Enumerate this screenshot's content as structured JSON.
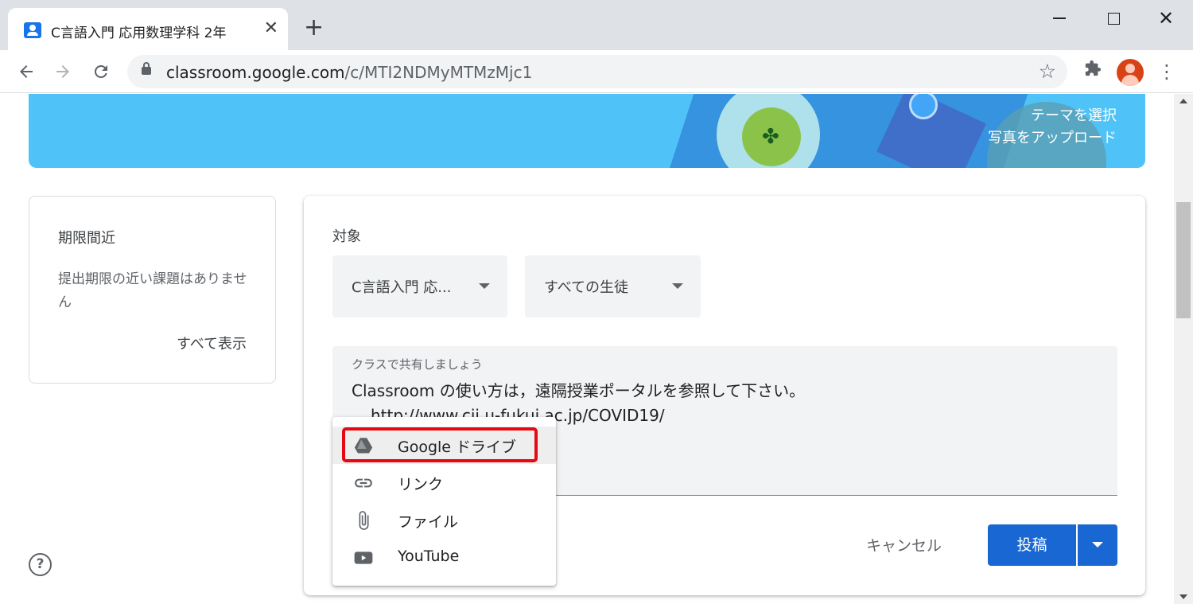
{
  "browser": {
    "tab_title": "C言語入門 応用数理学科 2年",
    "tab_close": "✕",
    "new_tab": "+",
    "url_host": "classroom.google.com",
    "url_path": "/c/MTI2NDMyMTMzMjc1",
    "window_close": "✕"
  },
  "banner": {
    "select_theme": "テーマを選択",
    "upload_photo": "写真をアップロード"
  },
  "upcoming": {
    "title": "期限間近",
    "message": "提出期限の近い課題はありません",
    "view_all": "すべて表示"
  },
  "composer": {
    "target_label": "対象",
    "class_select": "C言語入門 応...",
    "students_select": "すべての生徒",
    "placeholder": "クラスで共有しましょう",
    "text_line1": "Classroom の使い方は，遠隔授業ポータルを参照して下さい。",
    "text_line2": "http://www.cii.u-fukui.ac.jp/COVID19/",
    "cancel": "キャンセル",
    "post": "投稿"
  },
  "add_menu": {
    "items": [
      {
        "label": "Google ドライブ",
        "icon": "google-drive-icon",
        "highlighted": true
      },
      {
        "label": "リンク",
        "icon": "link-icon"
      },
      {
        "label": "ファイル",
        "icon": "paperclip-icon"
      },
      {
        "label": "YouTube",
        "icon": "youtube-icon"
      }
    ]
  },
  "colors": {
    "banner": "#4fc3f7",
    "post_button": "#1967d2",
    "highlight_frame": "#e50914"
  }
}
